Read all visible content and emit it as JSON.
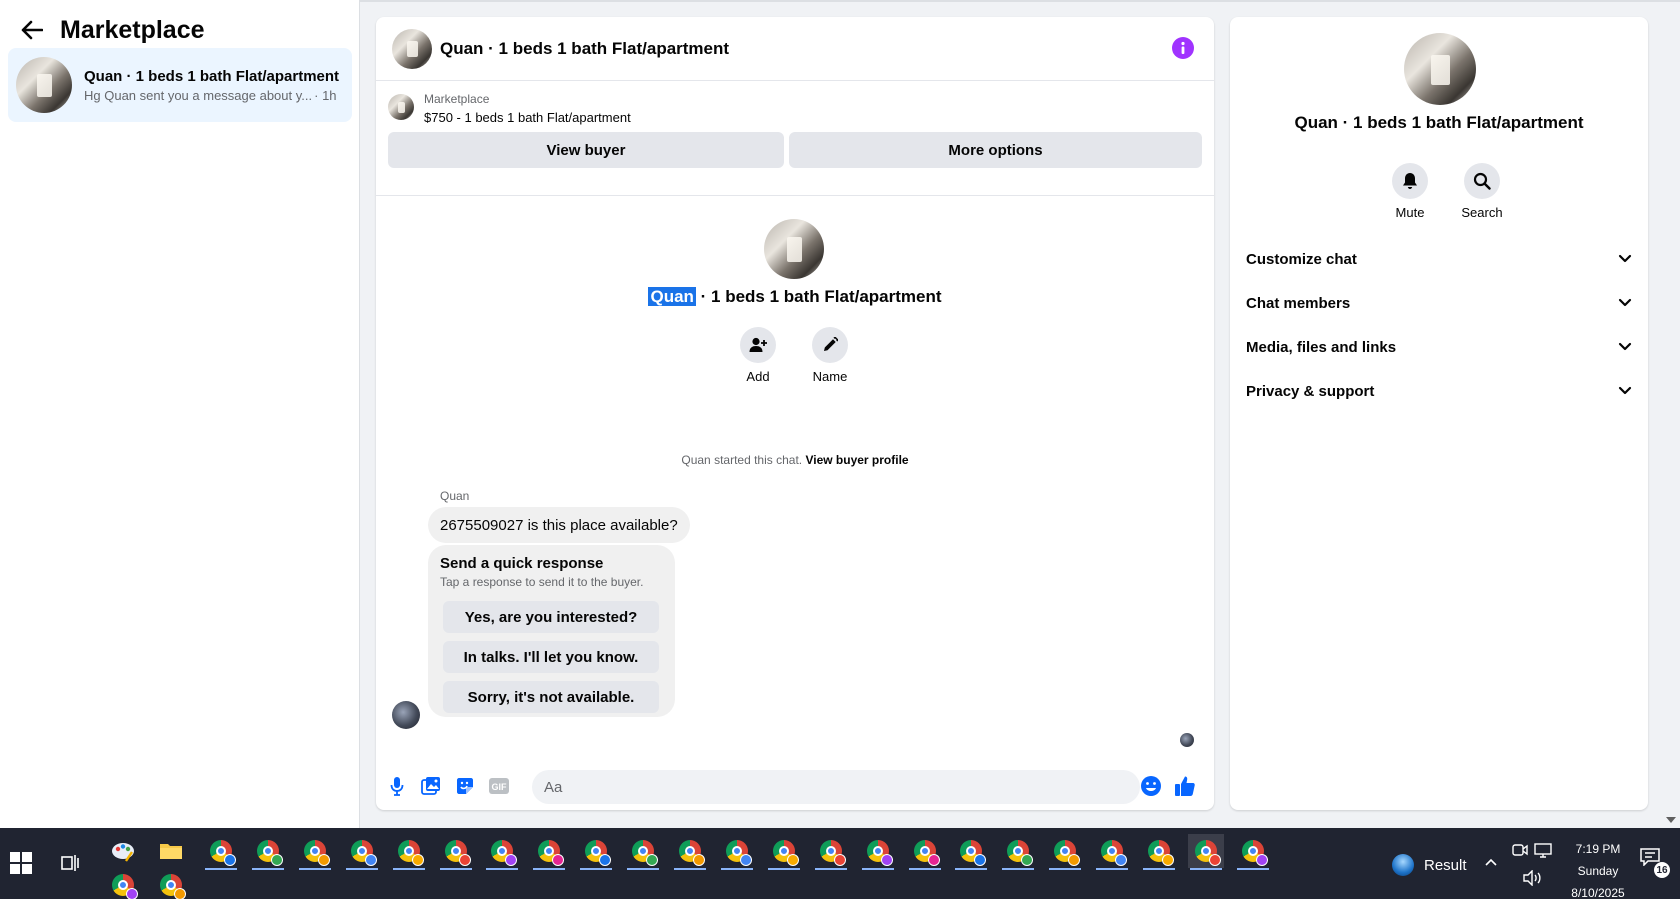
{
  "left": {
    "title": "Marketplace",
    "conversation": {
      "title": "Quan · 1 beds 1 bath Flat/apartment",
      "snippet": "Hg Quan sent you a message about y...",
      "time": "· 1h"
    }
  },
  "chat": {
    "header_title": "Quan · 1 beds 1 bath Flat/apartment",
    "listing": {
      "source": "Marketplace",
      "price_title": "$750 - 1 beds 1 bath Flat/apartment"
    },
    "buttons": {
      "view_buyer": "View buyer",
      "more_options": "More options"
    },
    "profile": {
      "name_selected": "Quan",
      "name_rest": " · 1 beds 1 bath Flat/apartment",
      "add_label": "Add",
      "name_label": "Name"
    },
    "started": {
      "text": "Quan started this chat. ",
      "link": "View buyer profile"
    },
    "message": {
      "sender": "Quan",
      "text": "2675509027 is this place available?"
    },
    "quick_response": {
      "title": "Send a quick response",
      "subtitle": "Tap a response to send it to the buyer.",
      "options": [
        "Yes, are you interested?",
        "In talks. I'll let you know.",
        "Sorry, it's not available."
      ]
    },
    "composer": {
      "placeholder": "Aa",
      "value": ""
    }
  },
  "info": {
    "title": "Quan · 1 beds 1 bath Flat/apartment",
    "mute_label": "Mute",
    "search_label": "Search",
    "rows": [
      "Customize chat",
      "Chat members",
      "Media, files and links",
      "Privacy & support"
    ]
  },
  "taskbar": {
    "result_label": "Result",
    "time": "7:19 PM",
    "day": "Sunday",
    "date": "8/10/2025",
    "notification_count": "16",
    "badge_colors": [
      "#1a73e8",
      "#34a853",
      "#f29900",
      "#4285f4",
      "#f9ab00",
      "#ea4335",
      "#a142f4",
      "#e52592"
    ]
  },
  "colors": {
    "accent_blue": "#0866ff",
    "info_purple": "#a033ff",
    "selected_conversation_bg": "#ebf5ff",
    "selection_highlight": "#1a73e8"
  }
}
